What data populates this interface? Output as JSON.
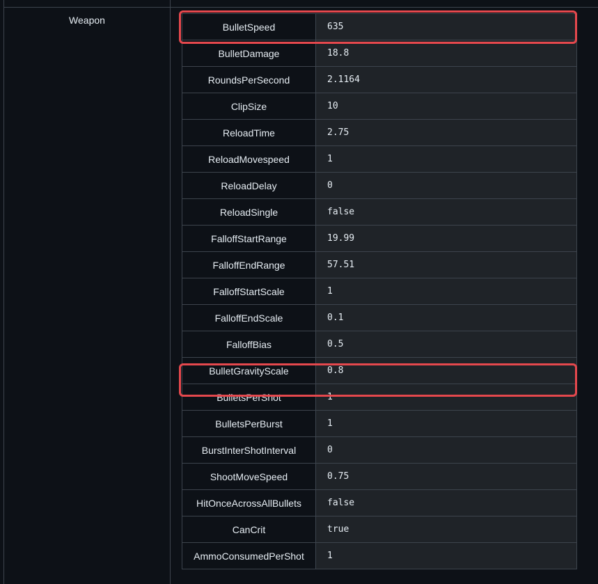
{
  "group": {
    "label": "Weapon"
  },
  "rows": [
    {
      "key": "BulletSpeed",
      "value": "635",
      "highlighted": true
    },
    {
      "key": "BulletDamage",
      "value": "18.8"
    },
    {
      "key": "RoundsPerSecond",
      "value": "2.1164"
    },
    {
      "key": "ClipSize",
      "value": "10"
    },
    {
      "key": "ReloadTime",
      "value": "2.75"
    },
    {
      "key": "ReloadMovespeed",
      "value": "1"
    },
    {
      "key": "ReloadDelay",
      "value": "0"
    },
    {
      "key": "ReloadSingle",
      "value": "false"
    },
    {
      "key": "FalloffStartRange",
      "value": "19.99"
    },
    {
      "key": "FalloffEndRange",
      "value": "57.51"
    },
    {
      "key": "FalloffStartScale",
      "value": "1"
    },
    {
      "key": "FalloffEndScale",
      "value": "0.1"
    },
    {
      "key": "FalloffBias",
      "value": "0.5"
    },
    {
      "key": "BulletGravityScale",
      "value": "0.8",
      "highlighted": true
    },
    {
      "key": "BulletsPerShot",
      "value": "1"
    },
    {
      "key": "BulletsPerBurst",
      "value": "1"
    },
    {
      "key": "BurstInterShotInterval",
      "value": "0"
    },
    {
      "key": "ShootMoveSpeed",
      "value": "0.75"
    },
    {
      "key": "HitOnceAcrossAllBullets",
      "value": "false"
    },
    {
      "key": "CanCrit",
      "value": "true"
    },
    {
      "key": "AmmoConsumedPerShot",
      "value": "1"
    }
  ],
  "colors": {
    "background": "#0d1117",
    "value_cell": "#1f2328",
    "border": "#3d444d",
    "highlight": "#e5484d",
    "text": "#e6edf3"
  }
}
